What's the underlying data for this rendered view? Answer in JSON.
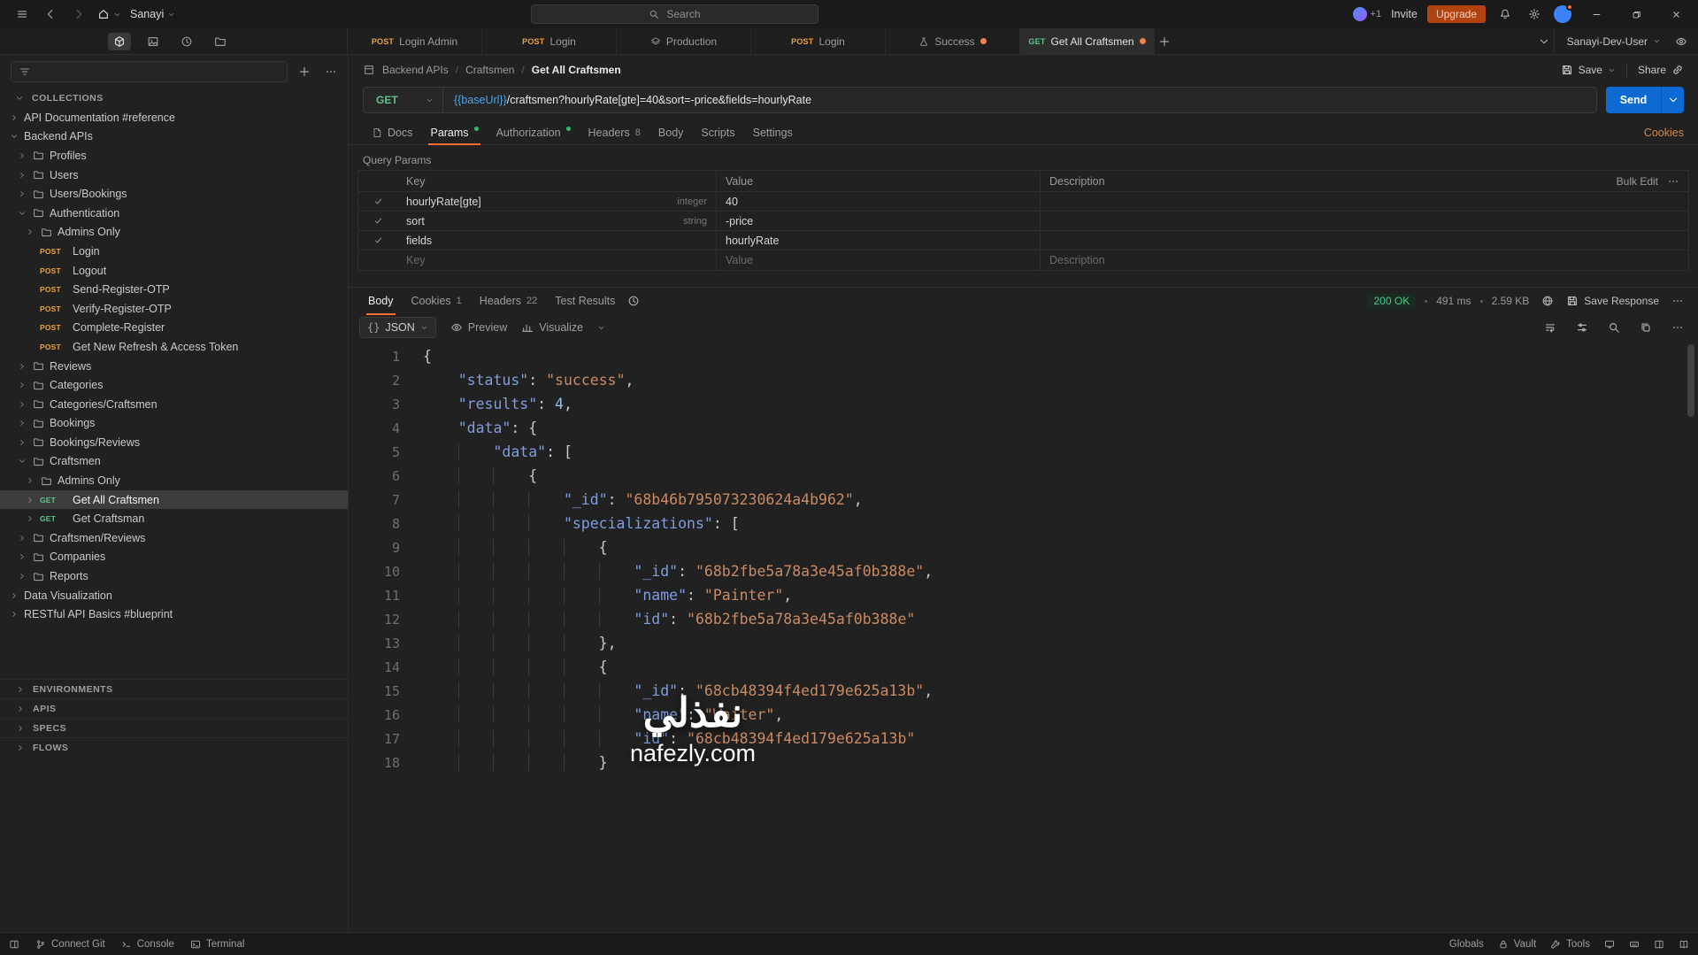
{
  "titlebar": {
    "workspace_name": "Sanayi",
    "search_placeholder": "Search",
    "collab_count": "+1",
    "invite_label": "Invite",
    "upgrade_label": "Upgrade"
  },
  "tabsbar": {
    "tabs": [
      {
        "kind": "request",
        "method": "POST",
        "label": "Login Admin",
        "active": false,
        "dirty": false
      },
      {
        "kind": "request",
        "method": "POST",
        "label": "Login",
        "active": false,
        "dirty": false
      },
      {
        "kind": "other",
        "icon": "layers",
        "label": "Production",
        "active": false,
        "dirty": false
      },
      {
        "kind": "request",
        "method": "POST",
        "label": "Login",
        "active": false,
        "dirty": false
      },
      {
        "kind": "other",
        "icon": "flask",
        "label": "Success",
        "active": false,
        "dirty": true
      },
      {
        "kind": "request",
        "method": "GET",
        "label": "Get All Craftsmen",
        "active": true,
        "dirty": true
      }
    ],
    "environment": "Sanayi-Dev-User"
  },
  "sidebar": {
    "collections_header": "COLLECTIONS",
    "tree": [
      {
        "level": 0,
        "kind": "collection",
        "chev": "right",
        "label": "API Documentation #reference"
      },
      {
        "level": 0,
        "kind": "collection",
        "chev": "down",
        "label": "Backend APIs"
      },
      {
        "level": 1,
        "kind": "folder",
        "chev": "right",
        "label": "Profiles"
      },
      {
        "level": 1,
        "kind": "folder",
        "chev": "right",
        "label": "Users"
      },
      {
        "level": 1,
        "kind": "folder",
        "chev": "right",
        "label": "Users/Bookings"
      },
      {
        "level": 1,
        "kind": "folder",
        "chev": "down",
        "label": "Authentication"
      },
      {
        "level": 2,
        "kind": "folder",
        "chev": "right",
        "label": "Admins Only"
      },
      {
        "level": 2,
        "kind": "request",
        "method": "POST",
        "chev": null,
        "label": "Login"
      },
      {
        "level": 2,
        "kind": "request",
        "method": "POST",
        "chev": null,
        "label": "Logout"
      },
      {
        "level": 2,
        "kind": "request",
        "method": "POST",
        "chev": null,
        "label": "Send-Register-OTP"
      },
      {
        "level": 2,
        "kind": "request",
        "method": "POST",
        "chev": null,
        "label": "Verify-Register-OTP"
      },
      {
        "level": 2,
        "kind": "request",
        "method": "POST",
        "chev": null,
        "label": "Complete-Register"
      },
      {
        "level": 2,
        "kind": "request",
        "method": "POST",
        "chev": null,
        "label": "Get New Refresh & Access Token"
      },
      {
        "level": 1,
        "kind": "folder",
        "chev": "right",
        "label": "Reviews"
      },
      {
        "level": 1,
        "kind": "folder",
        "chev": "right",
        "label": "Categories"
      },
      {
        "level": 1,
        "kind": "folder",
        "chev": "right",
        "label": "Categories/Craftsmen"
      },
      {
        "level": 1,
        "kind": "folder",
        "chev": "right",
        "label": "Bookings"
      },
      {
        "level": 1,
        "kind": "folder",
        "chev": "right",
        "label": "Bookings/Reviews"
      },
      {
        "level": 1,
        "kind": "folder",
        "chev": "down",
        "label": "Craftsmen"
      },
      {
        "level": 2,
        "kind": "folder",
        "chev": "right",
        "label": "Admins Only"
      },
      {
        "level": 2,
        "kind": "request",
        "method": "GET",
        "chev": "right",
        "label": "Get All Craftsmen",
        "selected": true
      },
      {
        "level": 2,
        "kind": "request",
        "method": "GET",
        "chev": "right",
        "label": "Get Craftsman"
      },
      {
        "level": 1,
        "kind": "folder",
        "chev": "right",
        "label": "Craftsmen/Reviews"
      },
      {
        "level": 1,
        "kind": "folder",
        "chev": "right",
        "label": "Companies"
      },
      {
        "level": 1,
        "kind": "folder",
        "chev": "right",
        "label": "Reports"
      },
      {
        "level": 0,
        "kind": "collection",
        "chev": "right",
        "label": "Data Visualization"
      },
      {
        "level": 0,
        "kind": "collection",
        "chev": "right",
        "label": "RESTful API Basics #blueprint"
      }
    ],
    "bottom_sections": [
      {
        "label": "ENVIRONMENTS"
      },
      {
        "label": "APIS"
      },
      {
        "label": "SPECS"
      },
      {
        "label": "FLOWS"
      }
    ]
  },
  "request": {
    "breadcrumb": [
      "Backend APIs",
      "Craftsmen",
      "Get All Craftsmen"
    ],
    "save_label": "Save",
    "share_label": "Share",
    "method": "GET",
    "url_variable": "{{baseUrl}}",
    "url_path": "/craftsmen?hourlyRate[gte]=40&sort=-price&fields=hourlyRate",
    "send_label": "Send",
    "tabs": [
      {
        "label": "Docs",
        "icon": "doc"
      },
      {
        "label": "Params",
        "active": true,
        "dot": true
      },
      {
        "label": "Authorization",
        "dot": true
      },
      {
        "label": "Headers",
        "count": "8"
      },
      {
        "label": "Body"
      },
      {
        "label": "Scripts"
      },
      {
        "label": "Settings"
      }
    ],
    "cookies_link": "Cookies",
    "query_params": {
      "section_label": "Query Params",
      "headers": [
        "Key",
        "Value",
        "Description"
      ],
      "bulk_edit_label": "Bulk Edit",
      "rows": [
        {
          "checked": true,
          "key": "hourlyRate[gte]",
          "type": "integer",
          "value": "40",
          "description": ""
        },
        {
          "checked": true,
          "key": "sort",
          "type": "string",
          "value": "-price",
          "description": ""
        },
        {
          "checked": true,
          "key": "fields",
          "type": "",
          "value": "hourlyRate",
          "description": ""
        }
      ],
      "placeholder_row": {
        "key": "Key",
        "value": "Value",
        "description": "Description"
      }
    }
  },
  "response": {
    "tabs": [
      {
        "label": "Body",
        "active": true
      },
      {
        "label": "Cookies",
        "count": "1"
      },
      {
        "label": "Headers",
        "count": "22"
      },
      {
        "label": "Test Results"
      }
    ],
    "status": "200 OK",
    "time": "491 ms",
    "size": "2.59 KB",
    "save_response_label": "Save Response",
    "format": "JSON",
    "preview_label": "Preview",
    "visualize_label": "Visualize",
    "body_lines": [
      {
        "i": 0,
        "t": [
          [
            "p",
            "{"
          ]
        ]
      },
      {
        "i": 4,
        "t": [
          [
            "k",
            "\"status\""
          ],
          [
            "p",
            ": "
          ],
          [
            "s",
            "\"success\""
          ],
          [
            "p",
            ","
          ]
        ]
      },
      {
        "i": 4,
        "t": [
          [
            "k",
            "\"results\""
          ],
          [
            "p",
            ": "
          ],
          [
            "n",
            "4"
          ],
          [
            "p",
            ","
          ]
        ]
      },
      {
        "i": 4,
        "t": [
          [
            "k",
            "\"data\""
          ],
          [
            "p",
            ": "
          ],
          [
            "p",
            "{"
          ]
        ]
      },
      {
        "i": 8,
        "t": [
          [
            "k",
            "\"data\""
          ],
          [
            "p",
            ": "
          ],
          [
            "p",
            "["
          ]
        ]
      },
      {
        "i": 12,
        "t": [
          [
            "p",
            "{"
          ]
        ]
      },
      {
        "i": 16,
        "t": [
          [
            "k",
            "\"_id\""
          ],
          [
            "p",
            ": "
          ],
          [
            "s",
            "\"68b46b795073230624a4b962\""
          ],
          [
            "p",
            ","
          ]
        ]
      },
      {
        "i": 16,
        "t": [
          [
            "k",
            "\"specializations\""
          ],
          [
            "p",
            ": "
          ],
          [
            "p",
            "["
          ]
        ]
      },
      {
        "i": 20,
        "t": [
          [
            "p",
            "{"
          ]
        ]
      },
      {
        "i": 24,
        "t": [
          [
            "k",
            "\"_id\""
          ],
          [
            "p",
            ": "
          ],
          [
            "s",
            "\"68b2fbe5a78a3e45af0b388e\""
          ],
          [
            "p",
            ","
          ]
        ]
      },
      {
        "i": 24,
        "t": [
          [
            "k",
            "\"name\""
          ],
          [
            "p",
            ": "
          ],
          [
            "s",
            "\"Painter\""
          ],
          [
            "p",
            ","
          ]
        ]
      },
      {
        "i": 24,
        "t": [
          [
            "k",
            "\"id\""
          ],
          [
            "p",
            ": "
          ],
          [
            "s",
            "\"68b2fbe5a78a3e45af0b388e\""
          ]
        ]
      },
      {
        "i": 20,
        "t": [
          [
            "p",
            "},"
          ]
        ]
      },
      {
        "i": 20,
        "t": [
          [
            "p",
            "{"
          ]
        ]
      },
      {
        "i": 24,
        "t": [
          [
            "k",
            "\"_id\""
          ],
          [
            "p",
            ": "
          ],
          [
            "s",
            "\"68cb48394f4ed179e625a13b\""
          ],
          [
            "p",
            ","
          ]
        ]
      },
      {
        "i": 24,
        "t": [
          [
            "k",
            "\"name\""
          ],
          [
            "p",
            ": "
          ],
          [
            "s",
            "\"Waiter\""
          ],
          [
            "p",
            ","
          ]
        ]
      },
      {
        "i": 24,
        "t": [
          [
            "k",
            "\"id\""
          ],
          [
            "p",
            ": "
          ],
          [
            "s",
            "\"68cb48394f4ed179e625a13b\""
          ]
        ]
      },
      {
        "i": 20,
        "t": [
          [
            "p",
            "}"
          ]
        ]
      }
    ]
  },
  "statusbar": {
    "left": [
      {
        "icon": "layout",
        "label": ""
      },
      {
        "icon": "git-branch",
        "label": "Connect Git"
      },
      {
        "icon": "console-prompt",
        "label": "Console"
      },
      {
        "icon": "terminal",
        "label": "Terminal"
      }
    ],
    "right_labels": [
      {
        "icon": "",
        "label": "Globals"
      },
      {
        "icon": "lock",
        "label": "Vault"
      },
      {
        "icon": "wrench",
        "label": "Tools"
      }
    ],
    "right_icons": [
      "display",
      "keyboard",
      "layout",
      "book"
    ]
  },
  "watermark": {
    "arabic": "نفذلي",
    "latin": "nafezly.com"
  },
  "colors": {
    "accent_orange": "#ff6c37",
    "send_blue": "#0c6ad2",
    "success_green": "#4ac885",
    "method_get": "#63c08b",
    "method_post": "#e8a33f",
    "unsaved_dot": "#f0814f"
  }
}
